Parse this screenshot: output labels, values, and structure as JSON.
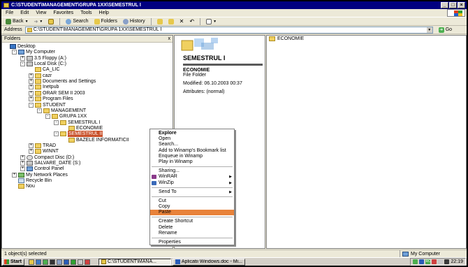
{
  "window": {
    "title": "C:\\STUDENT\\MANAGEMENT\\GRUPA 1XX\\SEMESTRUL I"
  },
  "menubar": [
    "File",
    "Edit",
    "View",
    "Favorites",
    "Tools",
    "Help"
  ],
  "toolbar": {
    "back": "Back",
    "search": "Search",
    "folders": "Folders",
    "history": "History"
  },
  "address": {
    "label": "Address",
    "value": "C:\\STUDENT\\MANAGEMENT\\GRUPA 1XX\\SEMESTRUL I",
    "go": "Go"
  },
  "folders_pane": {
    "title": "Folders",
    "close": "x",
    "tree": [
      {
        "label": "Desktop",
        "icon": "desktop-icon",
        "pm": ""
      },
      {
        "label": "My Computer",
        "icon": "computer-icon",
        "pm": "-"
      },
      {
        "label": "3.5 Floppy (A:)",
        "icon": "floppy-icon",
        "pm": "+"
      },
      {
        "label": "Local Disk (C:)",
        "icon": "drive-icon",
        "pm": "-"
      },
      {
        "label": "CA_LIC",
        "icon": "folder-icon",
        "pm": ""
      },
      {
        "label": "cazr",
        "icon": "folder-icon",
        "pm": "+"
      },
      {
        "label": "Documents and Settings",
        "icon": "folder-icon",
        "pm": "+"
      },
      {
        "label": "Inetpub",
        "icon": "folder-icon",
        "pm": "+"
      },
      {
        "label": "ORAR SEM II 2003",
        "icon": "folder-icon",
        "pm": "+"
      },
      {
        "label": "Program Files",
        "icon": "folder-icon",
        "pm": "+"
      },
      {
        "label": "STUDENT",
        "icon": "folder-icon",
        "pm": "-"
      },
      {
        "label": "MANAGEMENT",
        "icon": "folder-icon",
        "pm": "-"
      },
      {
        "label": "GRUPA 1XX",
        "icon": "folder-icon",
        "pm": "-"
      },
      {
        "label": "SEMESTRUL I",
        "icon": "folder-icon",
        "pm": "-"
      },
      {
        "label": "ECONOMIE",
        "icon": "folder-icon",
        "pm": ""
      },
      {
        "label": "SEMESTRUL II",
        "icon": "folder-icon",
        "pm": "-"
      },
      {
        "label": "BAZELE INFORMATICII",
        "icon": "folder-icon",
        "pm": ""
      },
      {
        "label": "TRAD",
        "icon": "folder-icon",
        "pm": "+"
      },
      {
        "label": "WINNT",
        "icon": "folder-icon",
        "pm": "+"
      },
      {
        "label": "Compact Disc (D:)",
        "icon": "cd-icon",
        "pm": "+"
      },
      {
        "label": "SALVARE_DATE (S:)",
        "icon": "drive-icon",
        "pm": "+"
      },
      {
        "label": "Control Panel",
        "icon": "control-panel-icon",
        "pm": "+"
      },
      {
        "label": "My Network Places",
        "icon": "network-icon",
        "pm": "+"
      },
      {
        "label": "Recycle Bin",
        "icon": "recycle-bin-icon",
        "pm": ""
      },
      {
        "label": "Nou",
        "icon": "folder-icon",
        "pm": ""
      }
    ]
  },
  "preview": {
    "folder_title": "SEMESTRUL I",
    "item_name": "ECONOMIE",
    "item_type": "File Folder",
    "modified": "Modified: 06.10.2003 00:37",
    "attributes": "Attributes: (normal)"
  },
  "filelist": {
    "items": [
      "ECONOMIE"
    ]
  },
  "context_menu": {
    "items": [
      {
        "label": "Explore",
        "bold": true
      },
      {
        "label": "Open"
      },
      {
        "label": "Search..."
      },
      {
        "label": "Add to Winamp's Bookmark list"
      },
      {
        "label": "Enqueue in Winamp"
      },
      {
        "label": "Play in Winamp"
      },
      {
        "sep": true
      },
      {
        "label": "Sharing..."
      },
      {
        "label": "WinRAR",
        "submenu": true,
        "icon": true
      },
      {
        "label": "WinZip",
        "submenu": true,
        "icon": true
      },
      {
        "sep": true
      },
      {
        "label": "Send To",
        "submenu": true
      },
      {
        "sep": true
      },
      {
        "label": "Cut"
      },
      {
        "label": "Copy"
      },
      {
        "label": "Paste",
        "highlight": true
      },
      {
        "sep": true
      },
      {
        "label": "Create Shortcut"
      },
      {
        "label": "Delete"
      },
      {
        "label": "Rename"
      },
      {
        "sep": true
      },
      {
        "label": "Properties"
      }
    ]
  },
  "status": {
    "left": "1 object(s) selected",
    "right": "My Computer"
  },
  "taskbar": {
    "start": "Start",
    "tasks": [
      {
        "label": "C:\\STUDENT\\MANA...",
        "active": true
      },
      {
        "label": "Aplicatii Windows.doc - Mi...",
        "active": false
      }
    ],
    "tray_ro": "RO",
    "clock": "22:19"
  },
  "colors": {
    "titlebar": "#000080",
    "selection": "#c9502a",
    "menu_highlight": "#e8823a"
  }
}
